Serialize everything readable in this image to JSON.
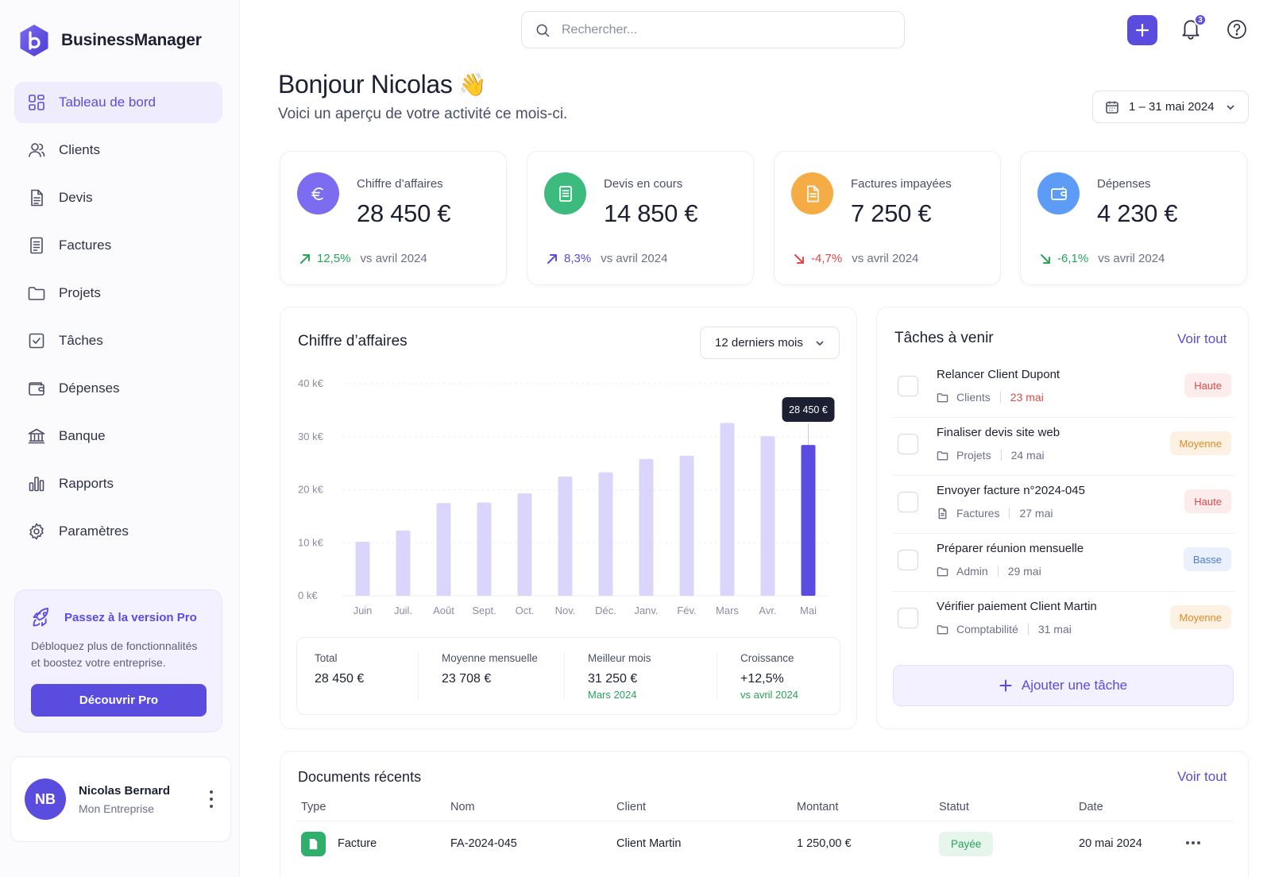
{
  "app": {
    "name": "BusinessManager"
  },
  "sidebar": {
    "items": [
      {
        "label": "Tableau de bord",
        "icon": "dashboard-icon",
        "active": true
      },
      {
        "label": "Clients",
        "icon": "users-icon"
      },
      {
        "label": "Devis",
        "icon": "document-icon"
      },
      {
        "label": "Factures",
        "icon": "invoice-icon"
      },
      {
        "label": "Projets",
        "icon": "folder-icon"
      },
      {
        "label": "Tâches",
        "icon": "checkbox-icon"
      },
      {
        "label": "Dépenses",
        "icon": "wallet-icon"
      },
      {
        "label": "Banque",
        "icon": "bank-icon"
      },
      {
        "label": "Rapports",
        "icon": "bar-chart-icon"
      },
      {
        "label": "Paramètres",
        "icon": "gear-icon"
      }
    ],
    "pro": {
      "title": "Passez à la version Pro",
      "text": "Débloquez plus de fonctionnalités et boostez votre entreprise.",
      "button": "Découvrir Pro"
    },
    "user": {
      "initials": "NB",
      "name": "Nicolas Bernard",
      "company": "Mon Entreprise"
    }
  },
  "topbar": {
    "search_placeholder": "Rechercher...",
    "notifications_count": "3"
  },
  "greeting": {
    "title": "Bonjour Nicolas",
    "emoji": "👋",
    "subtitle": "Voici un aperçu de votre activité ce mois-ci.",
    "date_range": "1 – 31 mai 2024"
  },
  "kpis": [
    {
      "label": "Chiffre d’affaires",
      "value": "28 450 €",
      "trend": "12,5%",
      "direction": "up",
      "good": true,
      "vs": "vs avril 2024",
      "color": "#7b6cf0",
      "icon": "euro-icon"
    },
    {
      "label": "Devis en cours",
      "value": "14 850 €",
      "trend": "8,3%",
      "direction": "up",
      "good": "neutral",
      "vs": "vs avril 2024",
      "color": "#3dba7e",
      "icon": "document-icon"
    },
    {
      "label": "Factures impayées",
      "value": "7 250 €",
      "trend": "-4,7%",
      "direction": "down",
      "good": false,
      "vs": "vs avril 2024",
      "color": "#f6ac44",
      "icon": "file-icon"
    },
    {
      "label": "Dépenses",
      "value": "4 230 €",
      "trend": "-6,1%",
      "direction": "down",
      "good": true,
      "vs": "vs avril 2024",
      "color": "#5d9cf6",
      "icon": "wallet-icon"
    }
  ],
  "revenue": {
    "title": "Chiffre d’affaires",
    "period": "12 derniers mois",
    "stats": [
      {
        "label": "Total",
        "value": "28 450 €",
        "sub": ""
      },
      {
        "label": "Moyenne mensuelle",
        "value": "23 708 €",
        "sub": ""
      },
      {
        "label": "Meilleur mois",
        "value": "31 250 €",
        "sub": "Mars 2024"
      },
      {
        "label": "Croissance",
        "value": "+12,5%",
        "sub": "vs avril 2024"
      }
    ]
  },
  "chart_data": {
    "type": "bar",
    "categories": [
      "Juin",
      "Juil.",
      "Août",
      "Sept.",
      "Oct.",
      "Nov.",
      "Déc.",
      "Janv.",
      "Fév.",
      "Mars",
      "Avr.",
      "Mai"
    ],
    "values": [
      10200,
      12300,
      17500,
      17600,
      19300,
      22500,
      23300,
      25800,
      26400,
      32600,
      30100,
      28450
    ],
    "ylim": [
      0,
      40000
    ],
    "yticks": [
      0,
      10000,
      20000,
      30000,
      40000
    ],
    "ytick_labels": [
      "0 k€",
      "10 k€",
      "20 k€",
      "30 k€",
      "40 k€"
    ],
    "highlight_index": 11,
    "tooltip": "28 450 €",
    "bar_color": "#dad6fb",
    "highlight_color": "#5b4ce0",
    "grid": true
  },
  "tasks": {
    "title": "Tâches à venir",
    "see_all": "Voir tout",
    "add_label": "Ajouter une tâche",
    "items": [
      {
        "name": "Relancer Client Dupont",
        "category": "Clients",
        "cat_icon": "folder-icon",
        "date": "23 mai",
        "overdue": true,
        "priority": "Haute",
        "level": "high"
      },
      {
        "name": "Finaliser devis site web",
        "category": "Projets",
        "cat_icon": "folder-icon",
        "date": "24 mai",
        "overdue": false,
        "priority": "Moyenne",
        "level": "mid"
      },
      {
        "name": "Envoyer facture n°2024-045",
        "category": "Factures",
        "cat_icon": "file-icon",
        "date": "27 mai",
        "overdue": false,
        "priority": "Haute",
        "level": "high"
      },
      {
        "name": "Préparer réunion mensuelle",
        "category": "Admin",
        "cat_icon": "folder-icon",
        "date": "29 mai",
        "overdue": false,
        "priority": "Basse",
        "level": "low"
      },
      {
        "name": "Vérifier paiement Client Martin",
        "category": "Comptabilité",
        "cat_icon": "folder-icon",
        "date": "31 mai",
        "overdue": false,
        "priority": "Moyenne",
        "level": "mid"
      }
    ]
  },
  "documents": {
    "title": "Documents récents",
    "see_all": "Voir tout",
    "headers": [
      "Type",
      "Nom",
      "Client",
      "Montant",
      "Statut",
      "Date"
    ],
    "rows": [
      {
        "type": "Facture",
        "name": "FA-2024-045",
        "client": "Client Martin",
        "amount": "1 250,00 €",
        "status": "Payée",
        "date": "20 mai 2024"
      }
    ]
  }
}
